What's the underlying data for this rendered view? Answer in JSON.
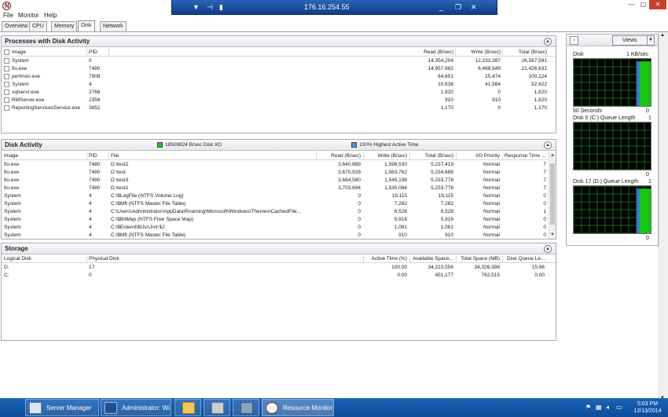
{
  "remote_bar": {
    "address": "176.16.254.55",
    "pin_icon": "pin-icon",
    "signal_icon": "signal-bars-icon"
  },
  "menu": [
    "File",
    "Monitor",
    "Help"
  ],
  "tabs": [
    "Overview",
    "CPU",
    "Memory",
    "Disk",
    "Network"
  ],
  "active_tab": "Disk",
  "processes": {
    "title": "Processes with Disk Activity",
    "columns": [
      "Image",
      "PID",
      "Read (B/sec)",
      "Write (B/sec)",
      "Total (B/sec)"
    ],
    "rows": [
      [
        "System",
        "0",
        "14,354,204",
        "12,233,387",
        "26,587,591"
      ],
      [
        "fio.exe",
        "7480",
        "14,957,682",
        "6,468,949",
        "21,426,631"
      ],
      [
        "perfmon.exe",
        "7908",
        "84,651",
        "15,474",
        "100,124"
      ],
      [
        "System",
        "4",
        "10,638",
        "41,984",
        "52,622"
      ],
      [
        "sqlservr.exe",
        "2768",
        "1,820",
        "0",
        "1,820"
      ],
      [
        "RMServer.exe",
        "2356",
        "910",
        "910",
        "1,820"
      ],
      [
        "ReportingServicesService.exe",
        "3852",
        "1,170",
        "0",
        "1,170"
      ]
    ]
  },
  "disk_activity": {
    "title": "Disk Activity",
    "legend_io": "18509824 B/sec Disk I/O",
    "legend_active": "100% Highest Active Time",
    "columns": [
      "Image",
      "PID",
      "File",
      "Read (B/sec)",
      "Write (B/sec)",
      "Total (B/sec)",
      "I/O Priority",
      "Response Time ..."
    ],
    "rows": [
      [
        "fio.exe",
        "7480",
        "D:\\test2",
        "3,640,889",
        "1,596,530",
        "5,237,419",
        "Normal",
        "7"
      ],
      [
        "fio.exe",
        "7480",
        "D:\\test",
        "3,670,926",
        "1,563,762",
        "5,234,688",
        "Normal",
        "7"
      ],
      [
        "fio.exe",
        "7480",
        "D:\\test3",
        "3,684,580",
        "1,549,198",
        "5,233,778",
        "Normal",
        "7"
      ],
      [
        "fio.exe",
        "7480",
        "D:\\test1",
        "3,703,694",
        "1,530,084",
        "5,233,778",
        "Normal",
        "7"
      ],
      [
        "System",
        "4",
        "C:\\$LogFile (NTFS Volume Log)",
        "0",
        "19,115",
        "19,115",
        "Normal",
        "0"
      ],
      [
        "System",
        "4",
        "C:\\$Mft (NTFS Master File Table)",
        "0",
        "7,282",
        "7,282",
        "Normal",
        "0"
      ],
      [
        "System",
        "4",
        "C:\\Users\\Administrator\\AppData\\Roaming\\Microsoft\\Windows\\Themes\\CachedFile...",
        "0",
        "6,528",
        "6,528",
        "Normal",
        "1"
      ],
      [
        "System",
        "4",
        "C:\\$BitMap (NTFS Free Space Map)",
        "0",
        "5,916",
        "5,916",
        "Normal",
        "0"
      ],
      [
        "System",
        "4",
        "C:\\$Extend\\$UsnJrnl:$J",
        "0",
        "1,081",
        "1,081",
        "Normal",
        "0"
      ],
      [
        "System",
        "4",
        "C:\\$Mft (NTFS Master File Table)",
        "0",
        "910",
        "910",
        "Normal",
        "0"
      ]
    ]
  },
  "storage": {
    "title": "Storage",
    "columns": [
      "Logical Disk",
      "Physical Disk",
      "Active Time (%)",
      "Available Space...",
      "Total Space (MB)",
      "Disk Queue Le..."
    ],
    "rows": [
      [
        "D:",
        "17",
        "100.00",
        "34,223,556",
        "34,326,398",
        "15.96"
      ],
      [
        "C:",
        "0",
        "0.00",
        "451,177",
        "762,515",
        "0.00"
      ]
    ]
  },
  "right_pane": {
    "views_label": "Views",
    "graphs": [
      {
        "title": "Disk",
        "scale": "1 KB/sec",
        "footer_left": "60 Seconds",
        "footer_right": "0",
        "activity": 0.95
      },
      {
        "title": "Disk 0 (C:) Queue Length",
        "scale": "1",
        "footer_left": "",
        "footer_right": "0",
        "activity": 0.0
      },
      {
        "title": "Disk 17 (D:) Queue Length",
        "scale": "1",
        "footer_left": "",
        "footer_right": "0",
        "activity": 0.95
      }
    ]
  },
  "taskbar": {
    "buttons": [
      "Server Manager",
      "Administrator: Wi...",
      "",
      "",
      "",
      "Resource Monitor"
    ],
    "time": "5:03 PM",
    "date": "12/13/2014"
  },
  "colors": {
    "accent": "#1a63b7",
    "graph_green": "#18c418",
    "graph_blue": "#3a78d8",
    "io_legend": "#19c419",
    "active_legend": "#4f8fe0"
  }
}
